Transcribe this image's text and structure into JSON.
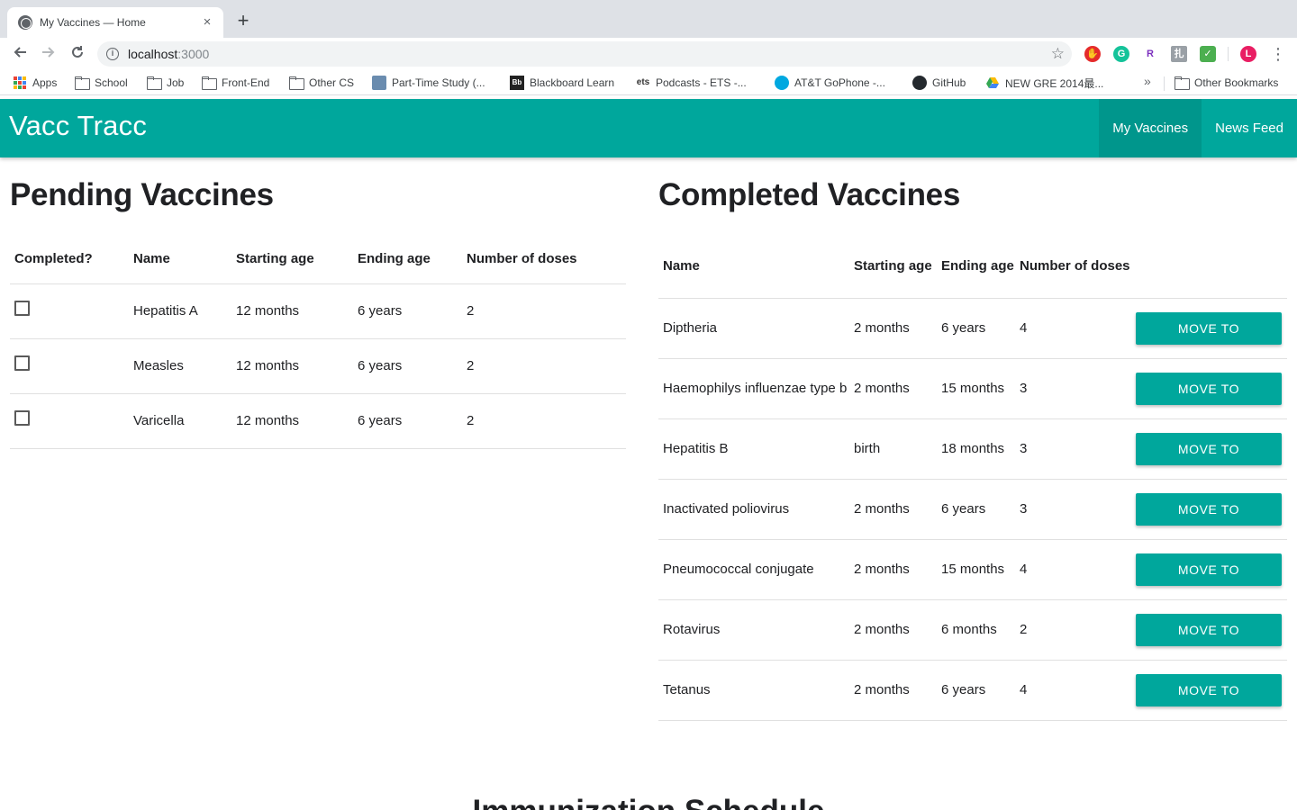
{
  "browser": {
    "tab_title": "My Vaccines — Home",
    "tab_close": "×",
    "new_tab": "+",
    "url_host": "localhost",
    "url_port": ":3000",
    "bookmarks": [
      {
        "label": "Apps",
        "icon": "apps-grid-icon"
      },
      {
        "label": "School",
        "icon": "folder-icon"
      },
      {
        "label": "Job",
        "icon": "folder-icon"
      },
      {
        "label": "Front-End",
        "icon": "folder-icon"
      },
      {
        "label": "Other CS",
        "icon": "folder-icon"
      },
      {
        "label": "Part-Time Study (...",
        "icon": "site-icon"
      },
      {
        "label": "Blackboard Learn",
        "icon": "blackboard-icon"
      },
      {
        "label": "Podcasts - ETS -...",
        "icon": "ets-icon"
      },
      {
        "label": "AT&T GoPhone -...",
        "icon": "att-icon"
      },
      {
        "label": "GitHub",
        "icon": "github-icon"
      },
      {
        "label": "NEW GRE 2014最...",
        "icon": "drive-icon"
      }
    ],
    "other_bookmarks": "Other Bookmarks",
    "profile_initial": "L",
    "extension_colors": [
      "#e52b2b",
      "#15c39a",
      "#7b2fbe",
      "#9aa0a6",
      "#4caf50"
    ]
  },
  "app": {
    "brand": "Vacc Tracc",
    "nav": [
      {
        "label": "My Vaccines",
        "active": true
      },
      {
        "label": "News Feed",
        "active": false
      }
    ],
    "accent_color": "#00a79c"
  },
  "pending": {
    "title": "Pending Vaccines",
    "headers": [
      "Completed?",
      "Name",
      "Starting age",
      "Ending age",
      "Number of doses"
    ],
    "rows": [
      {
        "name": "Hepatitis A",
        "start": "12 months",
        "end": "6 years",
        "doses": "2",
        "completed": false
      },
      {
        "name": "Measles",
        "start": "12 months",
        "end": "6 years",
        "doses": "2",
        "completed": false
      },
      {
        "name": "Varicella",
        "start": "12 months",
        "end": "6 years",
        "doses": "2",
        "completed": false
      }
    ]
  },
  "completed": {
    "title": "Completed Vaccines",
    "headers": [
      "Name",
      "Starting age",
      "Ending age",
      "Number of doses",
      ""
    ],
    "button_label": "MOVE TO",
    "rows": [
      {
        "name": "Diptheria",
        "start": "2 months",
        "end": "6 years",
        "doses": "4"
      },
      {
        "name": "Haemophilys influenzae type b",
        "start": "2 months",
        "end": "15 months",
        "doses": "3"
      },
      {
        "name": "Hepatitis B",
        "start": "birth",
        "end": "18 months",
        "doses": "3"
      },
      {
        "name": "Inactivated poliovirus",
        "start": "2 months",
        "end": "6 years",
        "doses": "3"
      },
      {
        "name": "Pneumococcal conjugate",
        "start": "2 months",
        "end": "15 months",
        "doses": "4"
      },
      {
        "name": "Rotavirus",
        "start": "2 months",
        "end": "6 months",
        "doses": "2"
      },
      {
        "name": "Tetanus",
        "start": "2 months",
        "end": "6 years",
        "doses": "4"
      }
    ]
  },
  "schedule": {
    "title": "Immunization Schedule"
  }
}
